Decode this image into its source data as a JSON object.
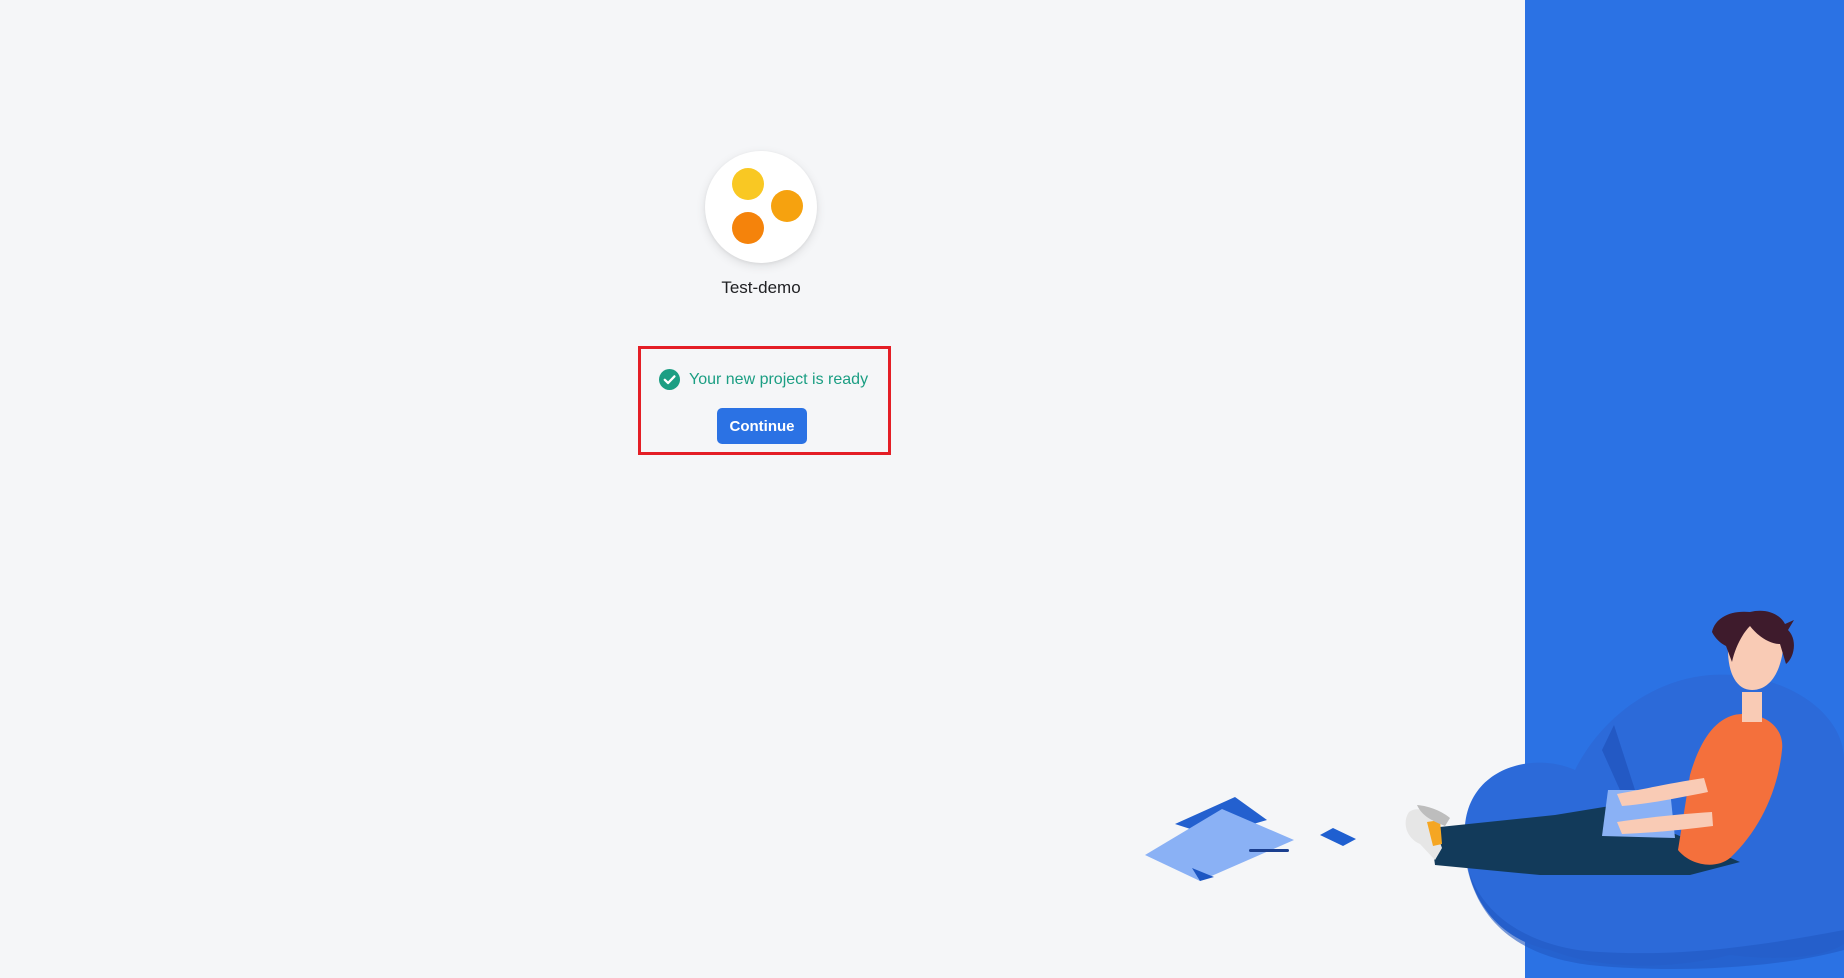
{
  "project": {
    "name": "Test-demo",
    "logo_colors": [
      "#f9c823",
      "#f6a20f",
      "#f5830b"
    ]
  },
  "status": {
    "message": "Your new project is ready",
    "color": "#1b9e83"
  },
  "actions": {
    "continue_label": "Continue"
  },
  "theme": {
    "accent": "#2b72e4",
    "background": "#f5f6f8",
    "highlight_border": "#e41e26"
  },
  "icons": {
    "status": "check-circle-icon"
  }
}
